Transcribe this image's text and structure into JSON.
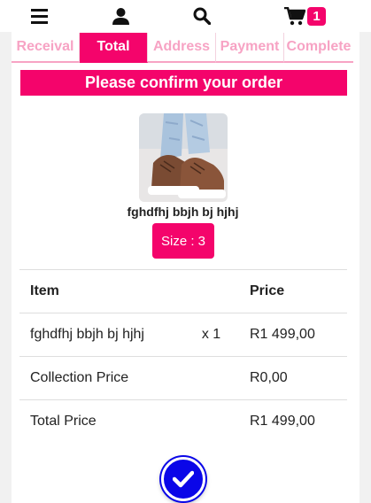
{
  "header": {
    "icons": [
      "menu-icon",
      "user-icon",
      "search-icon",
      "cart-icon"
    ],
    "cart_count": "1"
  },
  "steps": [
    {
      "label": "Receival",
      "active": false
    },
    {
      "label": "Total",
      "active": true
    },
    {
      "label": "Address",
      "active": false
    },
    {
      "label": "Payment",
      "active": false
    },
    {
      "label": "Complete",
      "active": false
    }
  ],
  "confirm": {
    "title": "Please confirm your order"
  },
  "product": {
    "name": "fghdfhj bbjh bj hjhj",
    "size_label": "Size : 3"
  },
  "table": {
    "headers": {
      "item": "Item",
      "qty": "",
      "price": "Price"
    },
    "rows": [
      {
        "item": "fghdfhj bbjh bj hjhj",
        "qty": "x 1",
        "price": "R1 499,00"
      },
      {
        "item": "Collection Price",
        "qty": "",
        "price": "R0,00"
      },
      {
        "item": "Total Price",
        "qty": "",
        "price": "R1 499,00"
      }
    ]
  },
  "colors": {
    "accent": "#f4046b",
    "accent_light": "#f7a3c4",
    "confirm_button": "#0a06e8"
  },
  "confirm_button_icon": "check-icon"
}
